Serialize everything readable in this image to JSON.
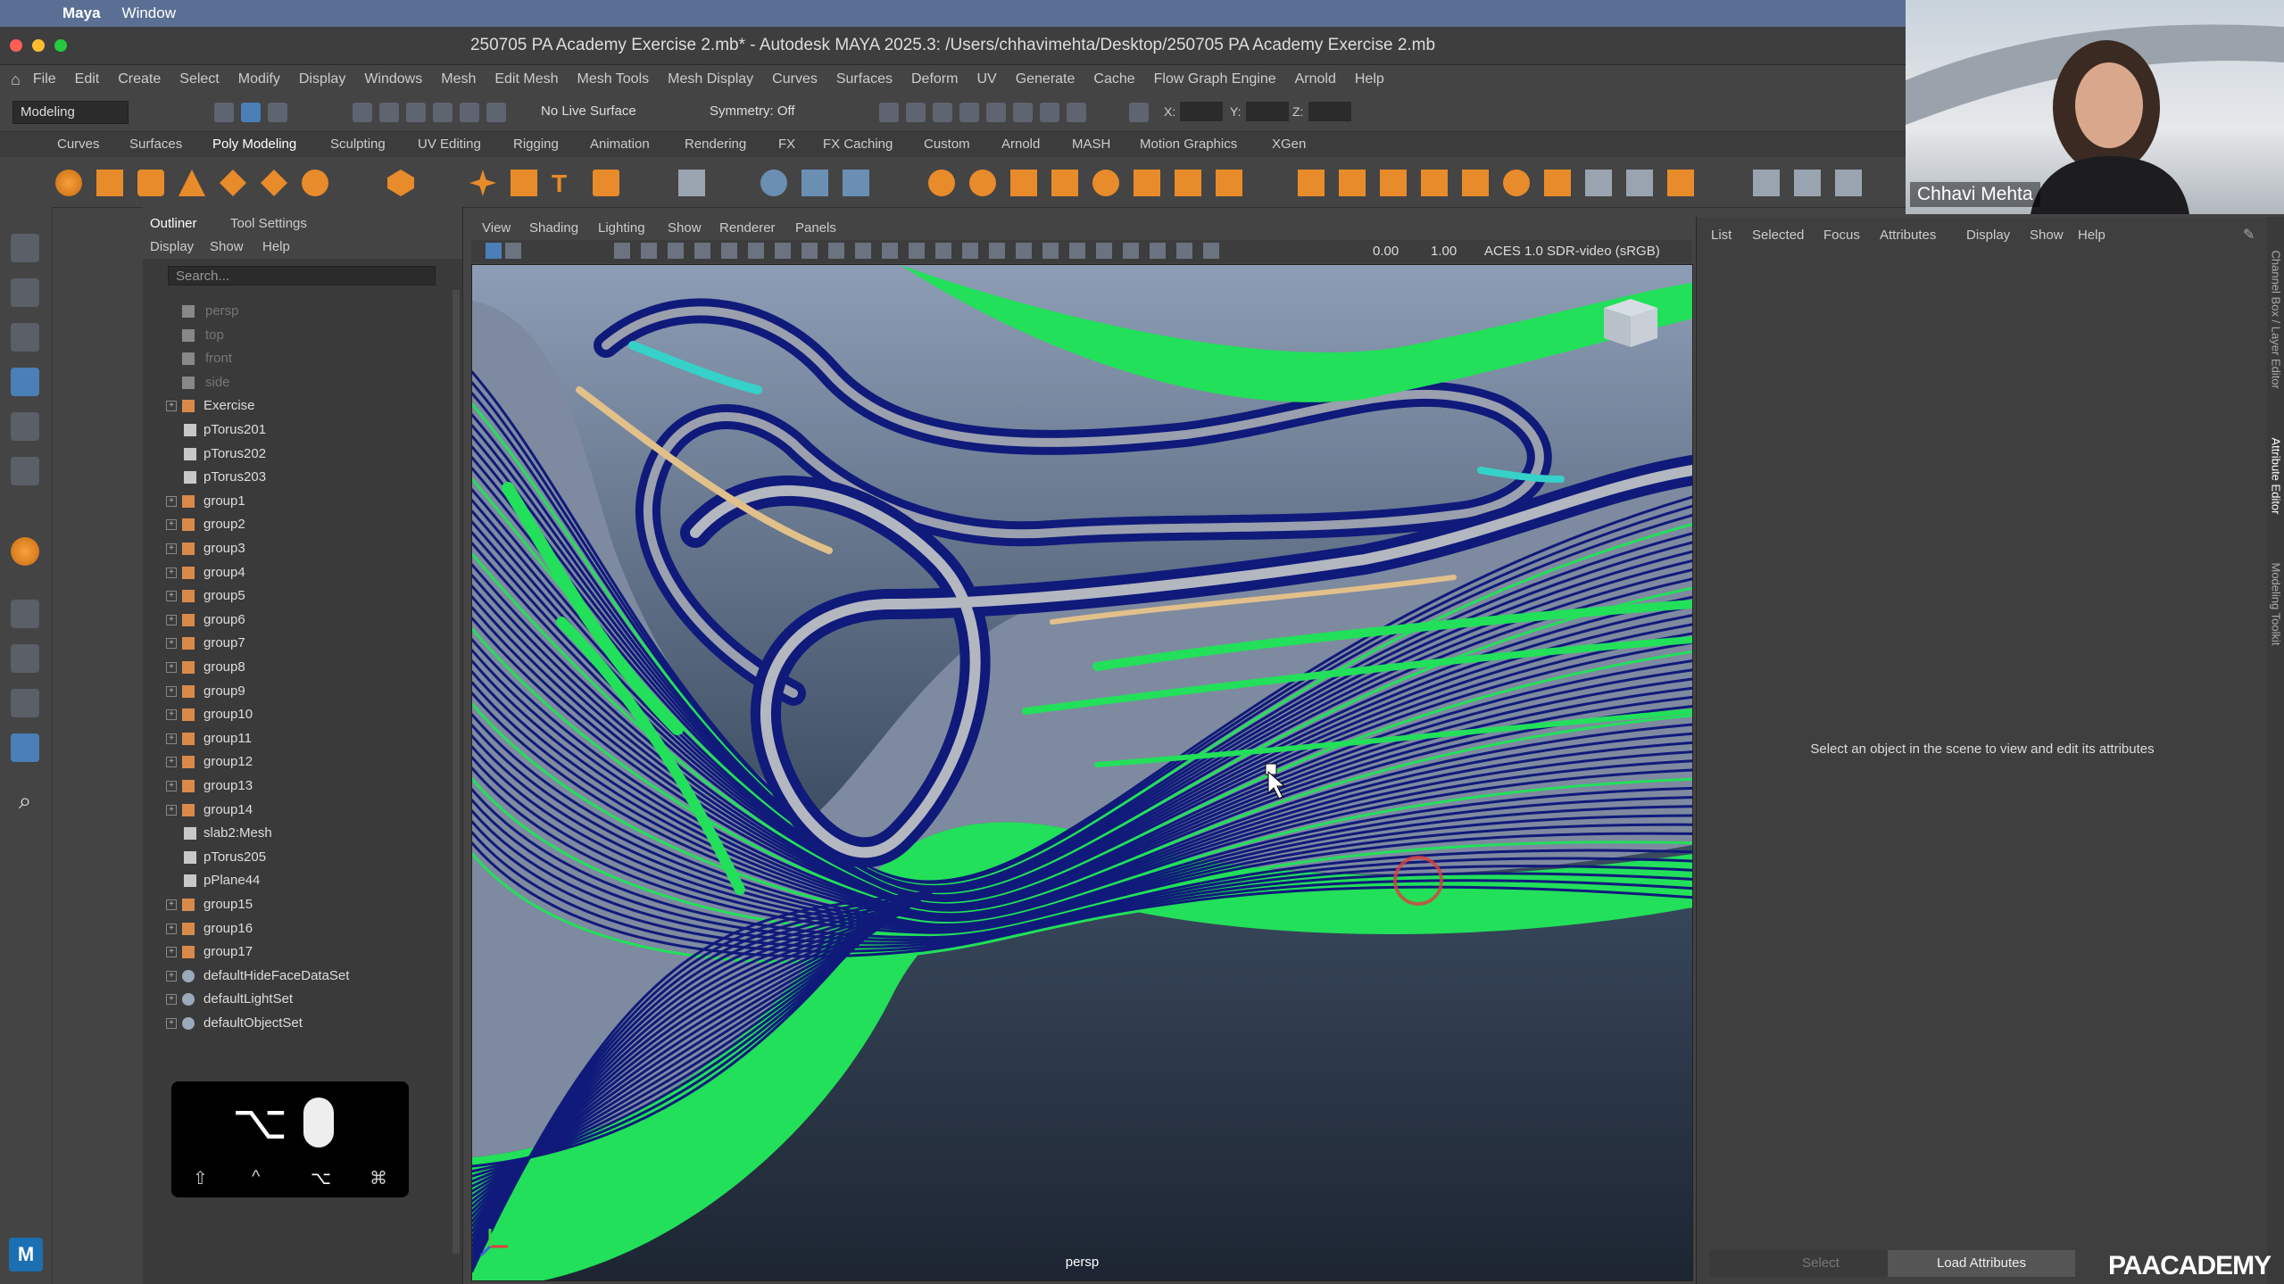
{
  "mac": {
    "app_name": "Maya",
    "menu_window": "Window"
  },
  "window": {
    "title": "250705 PA Academy Exercise 2.mb* - Autodesk MAYA 2025.3: /Users/chhavimehta/Desktop/250705 PA Academy Exercise 2.mb"
  },
  "menu": [
    "File",
    "Edit",
    "Create",
    "Select",
    "Modify",
    "Display",
    "Windows",
    "Mesh",
    "Edit Mesh",
    "Mesh Tools",
    "Mesh Display",
    "Curves",
    "Surfaces",
    "Deform",
    "UV",
    "Generate",
    "Cache",
    "Flow Graph Engine",
    "Arnold",
    "Help"
  ],
  "status": {
    "mode": "Modeling",
    "live_surface": "No Live Surface",
    "symmetry": "Symmetry: Off",
    "x_label": "X:",
    "y_label": "Y:",
    "z_label": "Z:"
  },
  "shelf_tabs": [
    "Curves",
    "Surfaces",
    "Poly Modeling",
    "Sculpting",
    "UV Editing",
    "Rigging",
    "Animation",
    "Rendering",
    "FX",
    "FX Caching",
    "Custom",
    "Arnold",
    "MASH",
    "Motion Graphics",
    "XGen"
  ],
  "shelf_active": "Poly Modeling",
  "outliner": {
    "tabs": [
      "Outliner",
      "Tool Settings"
    ],
    "menu": [
      "Display",
      "Show",
      "Help"
    ],
    "search_placeholder": "Search...",
    "items": [
      {
        "label": "persp",
        "type": "camera"
      },
      {
        "label": "top",
        "type": "camera"
      },
      {
        "label": "front",
        "type": "camera"
      },
      {
        "label": "side",
        "type": "camera"
      },
      {
        "label": "Exercise",
        "type": "group"
      },
      {
        "label": "pTorus201",
        "type": "mesh"
      },
      {
        "label": "pTorus202",
        "type": "mesh"
      },
      {
        "label": "pTorus203",
        "type": "mesh"
      },
      {
        "label": "group1",
        "type": "group"
      },
      {
        "label": "group2",
        "type": "group"
      },
      {
        "label": "group3",
        "type": "group"
      },
      {
        "label": "group4",
        "type": "group"
      },
      {
        "label": "group5",
        "type": "group"
      },
      {
        "label": "group6",
        "type": "group"
      },
      {
        "label": "group7",
        "type": "group"
      },
      {
        "label": "group8",
        "type": "group"
      },
      {
        "label": "group9",
        "type": "group"
      },
      {
        "label": "group10",
        "type": "group"
      },
      {
        "label": "group11",
        "type": "group"
      },
      {
        "label": "group12",
        "type": "group"
      },
      {
        "label": "group13",
        "type": "group"
      },
      {
        "label": "group14",
        "type": "group"
      },
      {
        "label": "slab2:Mesh",
        "type": "mesh"
      },
      {
        "label": "pTorus205",
        "type": "mesh"
      },
      {
        "label": "pPlane44",
        "type": "mesh"
      },
      {
        "label": "group15",
        "type": "group"
      },
      {
        "label": "group16",
        "type": "group"
      },
      {
        "label": "group17",
        "type": "group"
      },
      {
        "label": "defaultHideFaceDataSet",
        "type": "set"
      },
      {
        "label": "defaultLightSet",
        "type": "set"
      },
      {
        "label": "defaultObjectSet",
        "type": "set"
      }
    ]
  },
  "key_overlay": {
    "main": "⌥",
    "keys": [
      "⇧",
      "^",
      "⌥",
      "⌘"
    ]
  },
  "viewport": {
    "menu": [
      "View",
      "Shading",
      "Lighting",
      "Show",
      "Renderer",
      "Panels"
    ],
    "value1": "0.00",
    "value2": "1.00",
    "color_space": "ACES 1.0 SDR-video (sRGB)",
    "camera_label": "persp"
  },
  "attribute_editor": {
    "menu": [
      "List",
      "Selected",
      "Focus",
      "Attributes",
      "Display",
      "Show",
      "Help"
    ],
    "message": "Select an object in the scene to view and edit its attributes",
    "select_label": "Select",
    "load_label": "Load Attributes"
  },
  "side_tabs": [
    "Channel Box / Layer Editor",
    "Attribute Editor",
    "Modeling Toolkit"
  ],
  "webcam": {
    "name": "Chhavi Mehta"
  },
  "brand": "PAACADEMY",
  "colors": {
    "accent_blue": "#4a7fb8",
    "wire_navy": "#101a7a",
    "surface_green": "#22e05a"
  }
}
